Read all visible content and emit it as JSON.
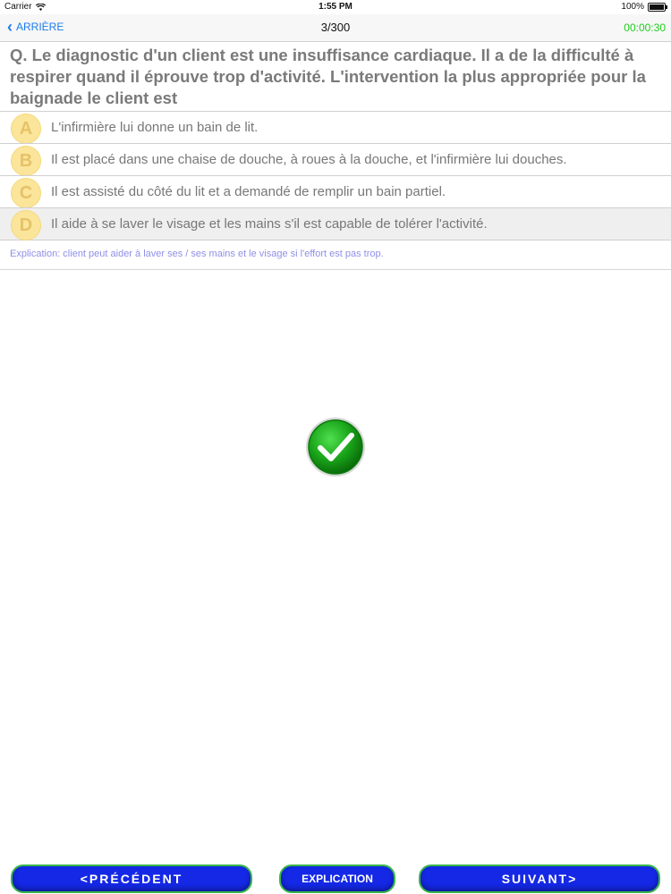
{
  "status": {
    "carrier": "Carrier",
    "time": "1:55 PM",
    "battery": "100%"
  },
  "nav": {
    "back_label": "ARRIÈRE",
    "title": "3/300",
    "timer": "00:00:30"
  },
  "question": "Q. Le diagnostic d'un client est une insuffisance cardiaque. Il a de la difficulté à respirer quand il éprouve trop d'activité. L'intervention la plus appropriée pour la baignade le client est",
  "options": [
    {
      "letter": "A",
      "text": "L'infirmière lui donne un bain de lit."
    },
    {
      "letter": "B",
      "text": " Il est placé dans une chaise de douche, à roues à la douche, et l'infirmière lui douches."
    },
    {
      "letter": "C",
      "text": "Il est assisté du côté du lit et a demandé de remplir un bain partiel."
    },
    {
      "letter": "D",
      "text": "Il aide à se laver le visage et les mains s'il est capable de tolérer l'activité."
    }
  ],
  "explanation": "Explication: client peut aider à laver ses / ses mains et le visage si l'effort est pas trop.",
  "buttons": {
    "prev": "<PRÉCÉDENT",
    "explication": "EXPLICATION",
    "next": "SUIVANT>"
  },
  "colors": {
    "accent": "#1a7cf0",
    "timer": "#1ed01e",
    "button": "#1428e6",
    "check": "#19a319"
  }
}
